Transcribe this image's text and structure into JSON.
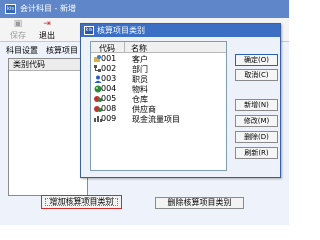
{
  "main_window": {
    "title": "会计科目 - 新增",
    "toolbar": {
      "save_label": "保存",
      "exit_label": "退出"
    },
    "tabs": [
      "科目设置",
      "核算项目"
    ],
    "list_header": "类别代码",
    "add_button_label": "增加核算项目类别",
    "delete_button_label": "删除核算项目类别"
  },
  "dialog": {
    "title": "核算项目类别",
    "columns": {
      "code": "代码",
      "name": "名称"
    },
    "rows": [
      {
        "code": "001",
        "name": "客户",
        "icon": "customer-icon"
      },
      {
        "code": "002",
        "name": "部门",
        "icon": "department-icon"
      },
      {
        "code": "003",
        "name": "职员",
        "icon": "employee-icon"
      },
      {
        "code": "004",
        "name": "物料",
        "icon": "material-icon"
      },
      {
        "code": "005",
        "name": "仓库",
        "icon": "warehouse-icon"
      },
      {
        "code": "008",
        "name": "供应商",
        "icon": "supplier-icon"
      },
      {
        "code": "009",
        "name": "现金流量项目",
        "icon": "cashflow-icon"
      }
    ],
    "buttons": {
      "ok": "确定(O)",
      "cancel": "取消(C)",
      "add": "新增(N)",
      "edit": "修改(M)",
      "delete": "删除(D)",
      "refresh": "刷新(R)"
    }
  },
  "colors": {
    "titlebar_bg": "#5f86c8",
    "dialog_titlebar_bg": "#3b6fc4",
    "highlight_border": "#d12b2b"
  }
}
